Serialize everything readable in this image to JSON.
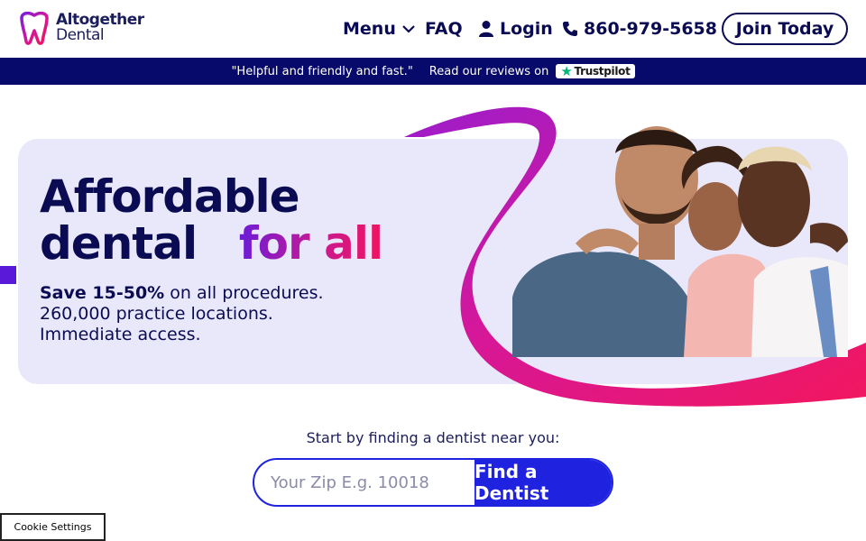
{
  "header": {
    "logo_line1": "Altogether",
    "logo_line2": "Dental",
    "nav": {
      "menu_label": "Menu",
      "faq_label": "FAQ",
      "login_label": "Login",
      "phone_label": "860-979-5658",
      "join_label": "Join Today"
    }
  },
  "banner": {
    "quote": "\"Helpful and friendly and fast.\"",
    "reviews_text": "Read our reviews on",
    "trustpilot_label": "Trustpilot"
  },
  "hero": {
    "title_line1": "Affordable",
    "title_line2_plain": "dental",
    "title_line2_accent": "for all",
    "savings_bold": "Save 15-50%",
    "savings_rest": " on all procedures.",
    "locations": "260,000 practice locations.",
    "access": "Immediate access."
  },
  "search": {
    "prompt": "Start by finding a dentist near you:",
    "placeholder": "Your Zip E.g. 10018",
    "value": "",
    "button_label": "Find a Dentist"
  },
  "cookie": {
    "label": "Cookie Settings"
  },
  "colors": {
    "navy": "#0a0b52",
    "banner_bg": "#07096b",
    "hero_bg": "#e9e8fb",
    "brand_blue": "#1f23e0",
    "accent_purple": "#6b1bd6",
    "accent_pink": "#f0155f",
    "trustpilot_green": "#00b67a"
  },
  "icons": [
    "tooth-logo-icon",
    "chevron-down-icon",
    "user-icon",
    "phone-icon",
    "trustpilot-star-icon"
  ]
}
